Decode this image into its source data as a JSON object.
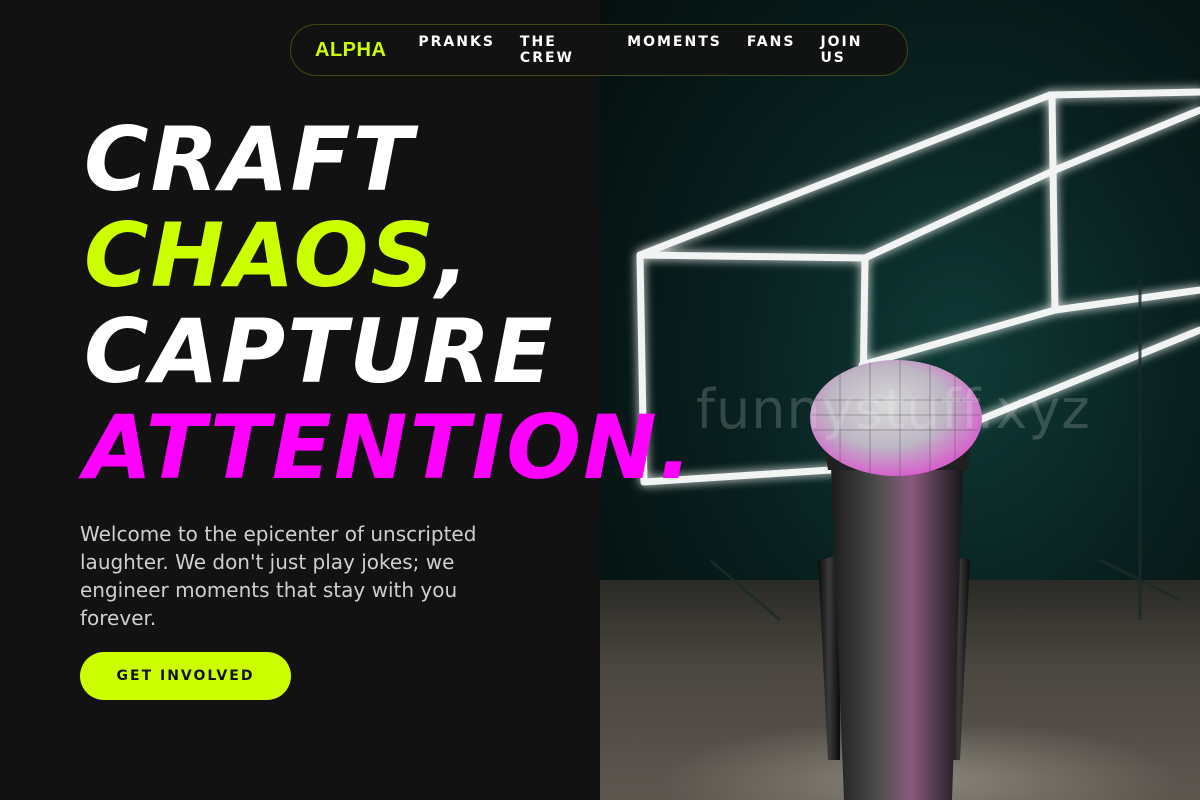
{
  "nav": {
    "brand": "ALPHA",
    "links": [
      {
        "label": "PRANKS"
      },
      {
        "label": "THE CREW"
      },
      {
        "label": "MOMENTS"
      },
      {
        "label": "FANS"
      },
      {
        "label": "JOIN US"
      }
    ]
  },
  "hero": {
    "headline": {
      "line1": "CRAFT",
      "line2": "CHAOS",
      "line2_punct": ",",
      "line3": "CAPTURE",
      "line4": "ATTENTION."
    },
    "intro": "Welcome to the epicenter of unscripted laughter. We don't just play jokes; we engineer moments that stay with you forever.",
    "cta_label": "GET INVOLVED",
    "image_watermark": "funnystuff.xyz"
  },
  "colors": {
    "background": "#121212",
    "accent_lime": "#ccff00",
    "accent_magenta": "#ff00ff",
    "text_white": "#ffffff",
    "text_muted": "#cfcfcf"
  },
  "icons": {
    "hero_image": "microphone-neon-stage-photo"
  }
}
